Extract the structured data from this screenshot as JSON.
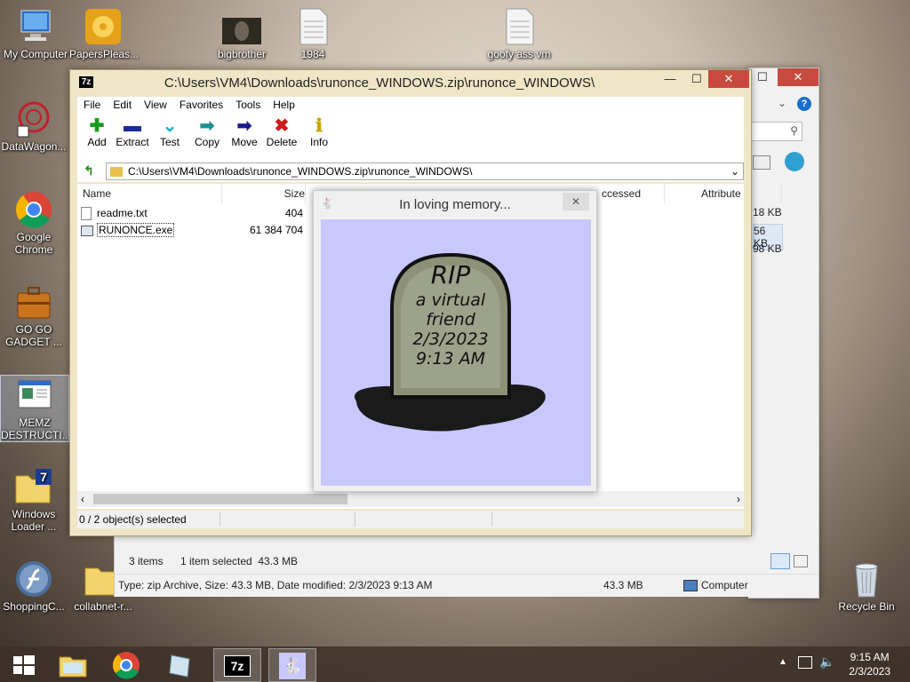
{
  "desktop": {
    "icons": [
      {
        "label": "My Computer",
        "icon": "computer-icon"
      },
      {
        "label": "PapersPleas...",
        "icon": "disc-icon"
      },
      {
        "label": "bigbrother",
        "icon": "image-icon"
      },
      {
        "label": "1984",
        "icon": "text-file-icon"
      },
      {
        "label": "goofy ass vm",
        "icon": "text-file-icon"
      },
      {
        "label": "DataWagon...",
        "icon": "shortcut-icon"
      },
      {
        "label": "Google\nChrome",
        "icon": "chrome-icon"
      },
      {
        "label": "GO GO\nGADGET ...",
        "icon": "briefcase-icon"
      },
      {
        "label": "MEMZ\nDESTRUCTI...",
        "icon": "program-icon"
      },
      {
        "label": "Windows\nLoader ...",
        "icon": "folder-icon"
      },
      {
        "label": "ShoppingC...",
        "icon": "flash-icon"
      },
      {
        "label": "collabnet-r...",
        "icon": "folder-icon"
      },
      {
        "label": "Recycle Bin",
        "icon": "recycle-bin-icon"
      }
    ]
  },
  "sevenzip": {
    "title": "C:\\Users\\VM4\\Downloads\\runonce_WINDOWS.zip\\runonce_WINDOWS\\",
    "menu": [
      "File",
      "Edit",
      "View",
      "Favorites",
      "Tools",
      "Help"
    ],
    "toolbar": [
      {
        "label": "Add",
        "icon": "plus-icon"
      },
      {
        "label": "Extract",
        "icon": "minus-icon"
      },
      {
        "label": "Test",
        "icon": "check-icon"
      },
      {
        "label": "Copy",
        "icon": "copy-arrow-icon"
      },
      {
        "label": "Move",
        "icon": "move-arrow-icon"
      },
      {
        "label": "Delete",
        "icon": "delete-x-icon"
      },
      {
        "label": "Info",
        "icon": "info-icon"
      }
    ],
    "address": "C:\\Users\\VM4\\Downloads\\runonce_WINDOWS.zip\\runonce_WINDOWS\\",
    "columns": {
      "name": "Name",
      "size": "Size",
      "accessed": "ccessed",
      "attributes": "Attribute"
    },
    "files": [
      {
        "name": "readme.txt",
        "size": "404"
      },
      {
        "name": "RUNONCE.exe",
        "size": "61 384 704"
      }
    ],
    "status": "0 / 2 object(s) selected"
  },
  "popup": {
    "title": "In loving memory...",
    "tombstone": {
      "line1": "RIP",
      "line2": "a virtual",
      "line3": "friend",
      "line4": "2/3/2023",
      "line5": "9:13 AM"
    }
  },
  "explorer": {
    "sizes": [
      "18 KB",
      "56 KB",
      "98 KB"
    ],
    "items_count": "3 items",
    "selected": "1 item selected  43.3 MB",
    "statusbar": "Type: zip Archive, Size: 43.3 MB, Date modified: 2/3/2023 9:13 AM",
    "status_size": "43.3 MB",
    "status_location": "Computer"
  },
  "taskbar": {
    "time": "9:15 AM",
    "date": "2/3/2023",
    "sevenzip_label": "7z"
  }
}
